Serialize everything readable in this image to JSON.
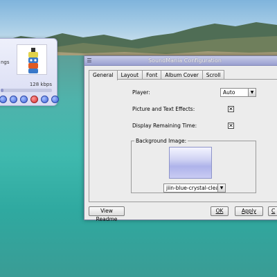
{
  "player": {
    "track_fragment": "ngs",
    "bitrate": "128 kbps",
    "progress_fraction": 0.06,
    "controls": [
      "previous-icon",
      "pause-icon",
      "play-icon",
      "stop-icon",
      "next-icon",
      "eject-icon"
    ]
  },
  "dialog": {
    "title": "SoundMania Configuration",
    "tabs": [
      "General",
      "Layout",
      "Font",
      "Album Cover",
      "Scroll"
    ],
    "active_tab": "General",
    "player_label": "Player:",
    "player_value": "Auto",
    "effects_label": "Picture and Text Effects:",
    "effects_checked": true,
    "remaining_label": "Display Remaining Time:",
    "remaining_checked": true,
    "background_group_label": "Background Image:",
    "background_value": "jiin-blue-crystal-clean",
    "readme_button": "View Readme",
    "ok_button": "OK",
    "apply_button": "Apply",
    "cancel_button_fragment": "C"
  },
  "colors": {
    "accent": "#9aa0d0",
    "sea": "#3fb9ae"
  }
}
